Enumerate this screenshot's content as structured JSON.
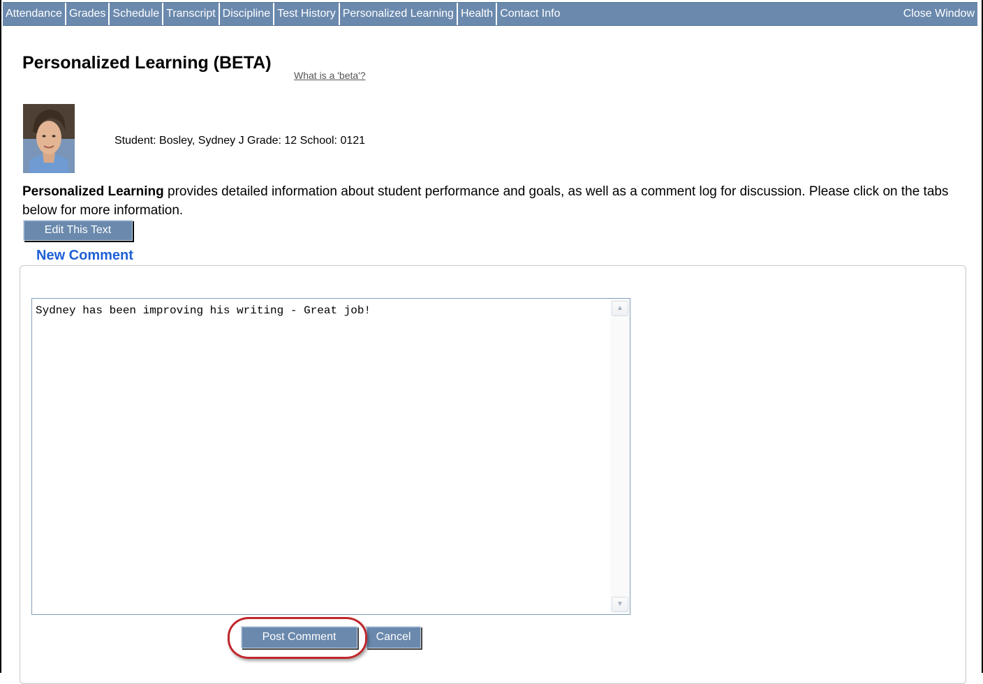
{
  "nav": {
    "items": [
      {
        "label": "Attendance"
      },
      {
        "label": "Grades"
      },
      {
        "label": "Schedule"
      },
      {
        "label": "Transcript"
      },
      {
        "label": "Discipline"
      },
      {
        "label": "Test History"
      },
      {
        "label": "Personalized Learning"
      },
      {
        "label": "Health"
      },
      {
        "label": "Contact Info"
      }
    ],
    "close_label": "Close Window",
    "bar_color": "#6a89ad"
  },
  "page": {
    "title": "Personalized Learning (BETA)",
    "beta_link": "What is a 'beta'?"
  },
  "student": {
    "info": "Student: Bosley, Sydney J Grade: 12 School: 0121",
    "photo_icon": "student-photo"
  },
  "description": {
    "bold": "Personalized Learning",
    "rest": " provides detailed information about student performance and goals, as well as a comment log for discussion. Please click on the tabs below for more information."
  },
  "edit_button": "Edit This Text",
  "comment_form": {
    "legend": "New Comment",
    "text": "Sydney has been improving his writing - Great job!",
    "post_label": "Post Comment",
    "cancel_label": "Cancel",
    "legend_color": "#1f5fd6",
    "highlight_color": "#c0262c"
  }
}
